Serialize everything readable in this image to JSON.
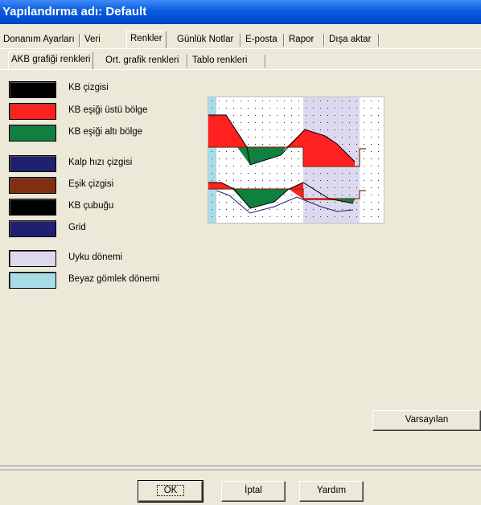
{
  "window": {
    "title": "Yapılandırma adı: Default"
  },
  "main_tabs": [
    "Donanım Ayarları",
    "Veri",
    "Renkler",
    "Günlük Notlar",
    "E-posta",
    "Rapor",
    "Dışa aktar"
  ],
  "main_tab_selected": "Renkler",
  "sub_tabs": [
    "AKB grafiği renkleri",
    "Ort. grafik renkleri",
    "Tablo renkleri"
  ],
  "sub_tab_selected": "AKB grafiği renkleri",
  "colors": [
    {
      "label": "KB çizgisi",
      "color": "#000000"
    },
    {
      "label": "KB eşiği üstü bölge",
      "color": "#ff2020"
    },
    {
      "label": "KB eşiği altı bölge",
      "color": "#108040"
    },
    {
      "label": "Kalp hızı çizgisi",
      "color": "#202070"
    },
    {
      "label": "Eşik çizgisi",
      "color": "#803010"
    },
    {
      "label": "KB çubuğu",
      "color": "#000000"
    },
    {
      "label": "Grid",
      "color": "#202070"
    },
    {
      "label": "Uyku dönemi",
      "color": "#dcd8ee"
    },
    {
      "label": "Beyaz gömlek dönemi",
      "color": "#a8dce8"
    }
  ],
  "buttons": {
    "default_label": "Varsayılan",
    "ok_label": "OK",
    "cancel_label": "İptal",
    "help_label": "Yardım"
  }
}
